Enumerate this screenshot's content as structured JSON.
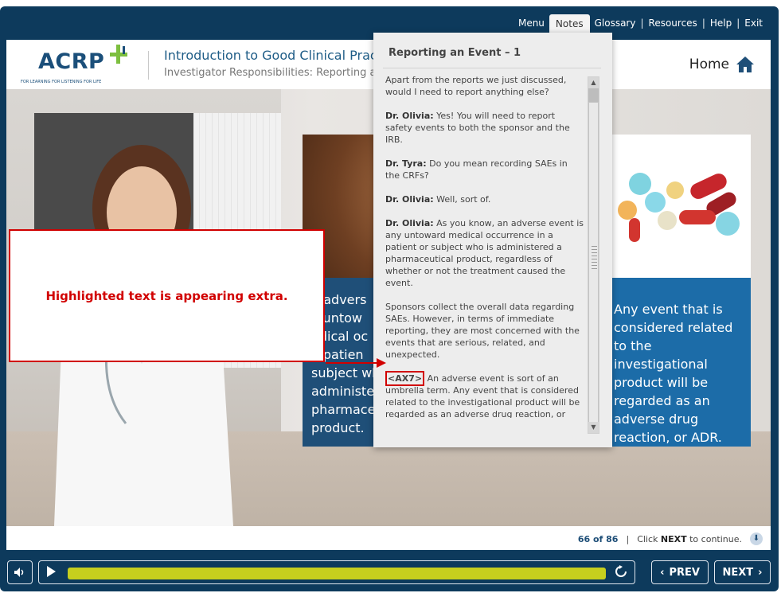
{
  "topnav": {
    "items": [
      {
        "label": "Menu"
      },
      {
        "label": "Notes"
      },
      {
        "label": "Glossary"
      },
      {
        "label": "Resources"
      },
      {
        "label": "Help"
      },
      {
        "label": "Exit"
      }
    ]
  },
  "header": {
    "logo_text": "ACRP",
    "logo_tagline": "FOR LEARNING  FOR LISTENING  FOR LIFE",
    "course_title": "Introduction to Good Clinical Pract",
    "course_subtitle": "Investigator Responsibilities: Reporting a",
    "home_label": "Home"
  },
  "slide": {
    "left_card_text": "n advers\ny untow\nedical oc\na patien\nsubject wh\nadministe\npharmace\nproduct.",
    "right_card_text": "Any event that is considered related to the investigational product will be regarded as an adverse drug reaction, or ADR."
  },
  "notes": {
    "title": "Reporting an Event – 1",
    "p1": "Apart from the reports we just discussed, would I need to report anything else?",
    "p2_speaker": "Dr. Olivia:",
    "p2_text": " Yes! You will need to report safety events to both the sponsor and the IRB.",
    "p3_speaker": "Dr. Tyra:",
    "p3_text": " Do you mean recording SAEs in the CRFs?",
    "p4_speaker": "Dr. Olivia:",
    "p4_text": " Well, sort of.",
    "p5_speaker": "Dr. Olivia:",
    "p5_text": " As you know, an adverse event is any untoward medical occurrence in a patient or subject who is administered a pharmaceutical product, regardless of whether or not the treatment caused the event.",
    "p6": "Sponsors collect the overall data regarding SAEs. However, in terms of immediate reporting, they are most concerned with the events that are serious, related, and unexpected.",
    "p7_tag": "<AX7>",
    "p7_text": " An adverse event is sort of an umbrella term. Any event that is considered related to the investigational product will be regarded as an adverse drug reaction, or ADR."
  },
  "callout": {
    "text": "Highlighted text is appearing extra."
  },
  "footer": {
    "page": "66 of 86",
    "continue_prefix": "Click ",
    "continue_bold": "NEXT",
    "continue_suffix": " to continue."
  },
  "controls": {
    "prev_label": "PREV",
    "next_label": "NEXT",
    "progress_fraction": 1.0
  },
  "colors": {
    "frame": "#0d3a5c",
    "accent_red": "#d10000",
    "seek_bar": "#c6cf1e",
    "card_blue": "#1c6ca8"
  }
}
